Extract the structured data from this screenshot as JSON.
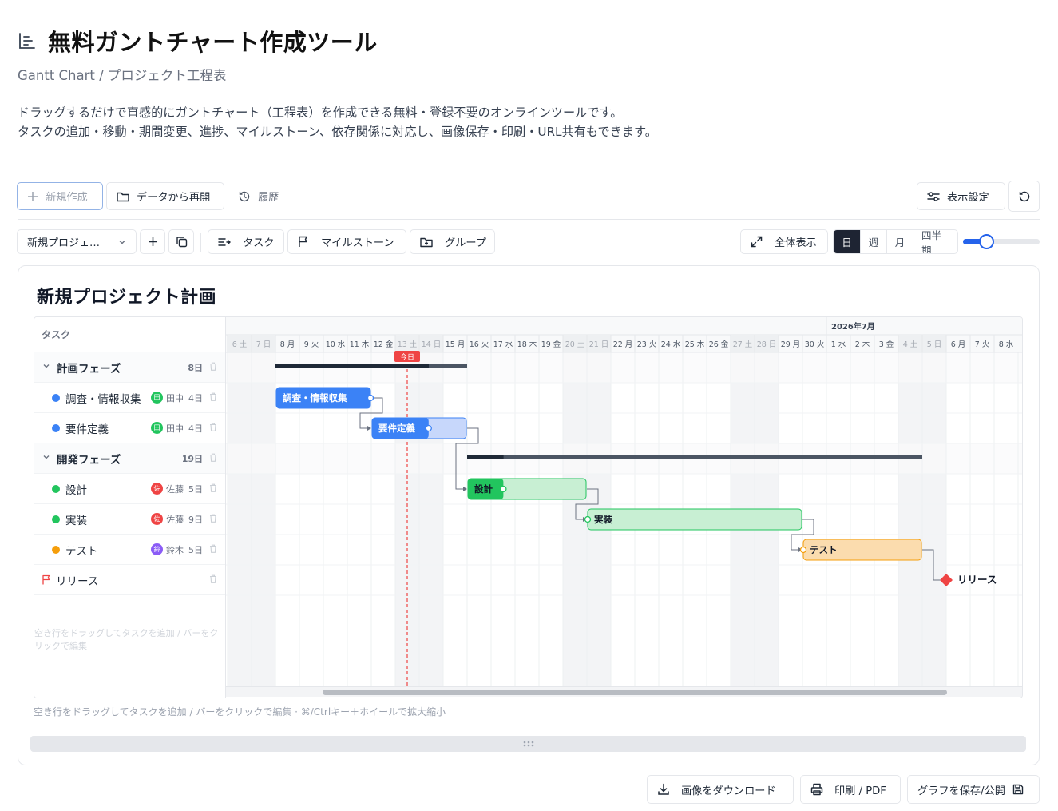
{
  "header": {
    "title": "無料ガントチャート作成ツール",
    "subtitle": "Gantt Chart / プロジェクト工程表",
    "desc_line1": "ドラッグするだけで直感的にガントチャート（工程表）を作成できる無料・登録不要のオンラインツールです。",
    "desc_line2": "タスクの追加・移動・期間変更、進捗、マイルストーン、依存関係に対応し、画像保存・印刷・URL共有もできます。"
  },
  "toolbar1": {
    "new_label": "新規作成",
    "resume_label": "データから再開",
    "history_label": "履歴",
    "display_settings_label": "表示設定"
  },
  "toolbar2": {
    "project_select": "新規プロジェ…",
    "task_label": "タスク",
    "milestone_label": "マイルストーン",
    "group_label": "グループ",
    "fit_label": "全体表示",
    "scales": [
      "日",
      "週",
      "月",
      "四半期"
    ],
    "active_scale": "日",
    "zoom_level": 0.3
  },
  "project": {
    "title": "新規プロジェクト計画"
  },
  "gantt": {
    "task_column_label": "タスク",
    "month_label": "2026年7月",
    "today_label": "今日",
    "days": [
      "6 土",
      "7 日",
      "8 月",
      "9 火",
      "10 水",
      "11 木",
      "12 金",
      "13 土",
      "14 日",
      "15 月",
      "16 火",
      "17 水",
      "18 木",
      "19 金",
      "20 土",
      "21 日",
      "22 月",
      "23 火",
      "24 水",
      "25 木",
      "26 金",
      "27 土",
      "28 日",
      "29 月",
      "30 火",
      "1 水",
      "2 木",
      "3 金",
      "4 土",
      "5 日",
      "6 月",
      "7 火",
      "8 水"
    ],
    "weekend_indexes": [
      0,
      1,
      7,
      8,
      14,
      15,
      21,
      22,
      28,
      29
    ],
    "today_index": 7.5,
    "month_start_index": 25,
    "rows": [
      {
        "type": "group",
        "name": "計画フェーズ",
        "duration": "8日",
        "start": 2,
        "end": 10,
        "progress": 0.8
      },
      {
        "type": "task",
        "name": "調査・情報収集",
        "color": "#3b82f6",
        "avatar": "田",
        "avatar_color": "#22c55e",
        "assignee": "田中",
        "duration": "4日",
        "start": 2,
        "end": 6,
        "progress": 1.0
      },
      {
        "type": "task",
        "name": "要件定義",
        "color": "#3b82f6",
        "avatar": "田",
        "avatar_color": "#22c55e",
        "assignee": "田中",
        "duration": "4日",
        "start": 6,
        "end": 10,
        "progress": 0.6
      },
      {
        "type": "group",
        "name": "開発フェーズ",
        "duration": "19日",
        "start": 10,
        "end": 29,
        "progress": 0.08
      },
      {
        "type": "task",
        "name": "設計",
        "color": "#22c55e",
        "avatar": "佐",
        "avatar_color": "#ef4444",
        "assignee": "佐藤",
        "duration": "5日",
        "start": 10,
        "end": 15,
        "progress": 0.3
      },
      {
        "type": "task",
        "name": "実装",
        "color": "#22c55e",
        "avatar": "佐",
        "avatar_color": "#ef4444",
        "assignee": "佐藤",
        "duration": "9日",
        "start": 15,
        "end": 24,
        "progress": 0
      },
      {
        "type": "task",
        "name": "テスト",
        "color": "#f59e0b",
        "avatar": "鈴",
        "avatar_color": "#8b5cf6",
        "assignee": "鈴木",
        "duration": "5日",
        "start": 24,
        "end": 29,
        "progress": 0
      },
      {
        "type": "milestone",
        "name": "リリース",
        "at": 30
      }
    ],
    "empty_hint": "空き行をドラッグしてタスクを追加 / バーをクリックで編集"
  },
  "footer": {
    "hint": "空き行をドラッグしてタスクを追加 / バーをクリックで編集 · ⌘/Ctrlキー＋ホイールで拡大縮小",
    "download_label": "画像をダウンロード",
    "print_label": "印刷 / PDF",
    "save_label": "グラフを保存/公開"
  }
}
